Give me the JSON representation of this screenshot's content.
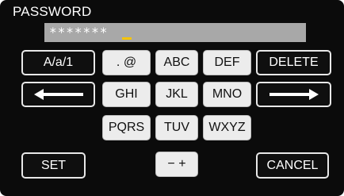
{
  "header": {
    "title": "PASSWORD"
  },
  "password_field": {
    "value": "*******"
  },
  "keys": {
    "mode_label": "A/a/1",
    "dot_at_label": ". @",
    "abc_label": "ABC",
    "def_label": "DEF",
    "delete_label": "DELETE",
    "ghi_label": "GHI",
    "jkl_label": "JKL",
    "mno_label": "MNO",
    "pqrs_label": "PQRS",
    "tuv_label": "TUV",
    "wxyz_label": "WXYZ",
    "set_label": "SET",
    "minus_plus_label": "− +",
    "cancel_label": "CANCEL",
    "left_arrow_icon": "arrow-left-icon",
    "right_arrow_icon": "arrow-right-icon"
  },
  "colors": {
    "background": "#0b0b0b",
    "field": "#a8a8a8",
    "cursor": "#f5c400",
    "key_light": "#ececec",
    "key_dark": "#0f0f0f",
    "key_border": "#e8e8e8"
  }
}
